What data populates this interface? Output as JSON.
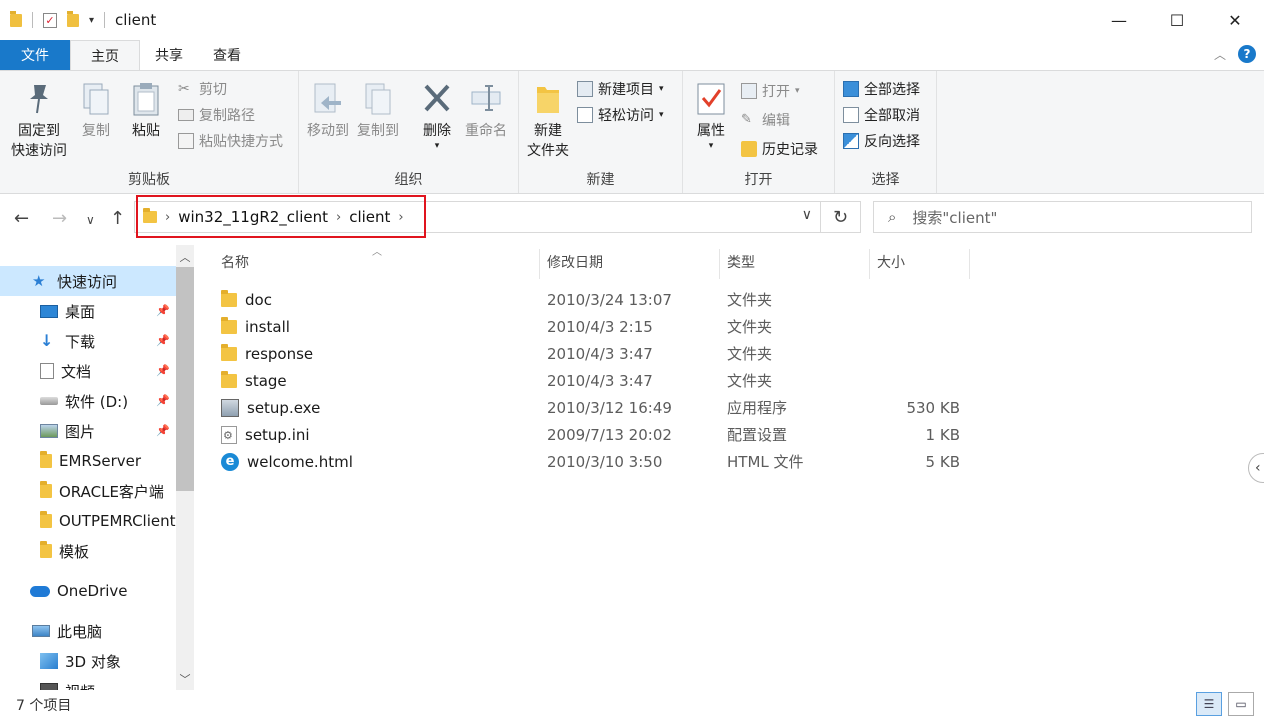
{
  "window": {
    "title": "client"
  },
  "ribbon_tabs": [
    "文件",
    "主页",
    "共享",
    "查看"
  ],
  "ribbon": {
    "clipboard": {
      "pin_line1": "固定到",
      "pin_line2": "快速访问",
      "copy": "复制",
      "paste": "粘贴",
      "cut": "剪切",
      "copy_path": "复制路径",
      "paste_shortcut": "粘贴快捷方式",
      "label": "剪贴板"
    },
    "organize": {
      "move_to": "移动到",
      "copy_to": "复制到",
      "delete": "删除",
      "rename": "重命名",
      "label": "组织"
    },
    "new": {
      "new_folder_line1": "新建",
      "new_folder_line2": "文件夹",
      "new_item": "新建项目",
      "easy_access": "轻松访问",
      "label": "新建"
    },
    "open": {
      "properties": "属性",
      "open": "打开",
      "edit": "编辑",
      "history": "历史记录",
      "label": "打开"
    },
    "select": {
      "select_all": "全部选择",
      "select_none": "全部取消",
      "invert": "反向选择",
      "label": "选择"
    }
  },
  "address": {
    "crumbs": [
      "win32_11gR2_client",
      "client"
    ],
    "search_placeholder": "搜索\"client\""
  },
  "nav": {
    "quick_access": "快速访问",
    "desktop": "桌面",
    "downloads": "下载",
    "documents": "文档",
    "drive_d": "软件 (D:)",
    "pictures": "图片",
    "emr": "EMRServer",
    "oracle": "ORACLE客户端",
    "outpemr": "OUTPEMRClient",
    "template": "模板",
    "onedrive": "OneDrive",
    "this_pc": "此电脑",
    "objects_3d": "3D 对象",
    "videos": "视频"
  },
  "columns": {
    "name": "名称",
    "date": "修改日期",
    "type": "类型",
    "size": "大小"
  },
  "files": [
    {
      "name": "doc",
      "date": "2010/3/24 13:07",
      "type": "文件夹",
      "size": "",
      "icon": "folder-icon"
    },
    {
      "name": "install",
      "date": "2010/4/3 2:15",
      "type": "文件夹",
      "size": "",
      "icon": "folder-icon"
    },
    {
      "name": "response",
      "date": "2010/4/3 3:47",
      "type": "文件夹",
      "size": "",
      "icon": "folder-icon"
    },
    {
      "name": "stage",
      "date": "2010/4/3 3:47",
      "type": "文件夹",
      "size": "",
      "icon": "folder-icon"
    },
    {
      "name": "setup.exe",
      "date": "2010/3/12 16:49",
      "type": "应用程序",
      "size": "530 KB",
      "icon": "exe-icon"
    },
    {
      "name": "setup.ini",
      "date": "2009/7/13 20:02",
      "type": "配置设置",
      "size": "1 KB",
      "icon": "ini-icon"
    },
    {
      "name": "welcome.html",
      "date": "2010/3/10 3:50",
      "type": "HTML 文件",
      "size": "5 KB",
      "icon": "html-icon"
    }
  ],
  "status": {
    "count": "7 个项目"
  }
}
